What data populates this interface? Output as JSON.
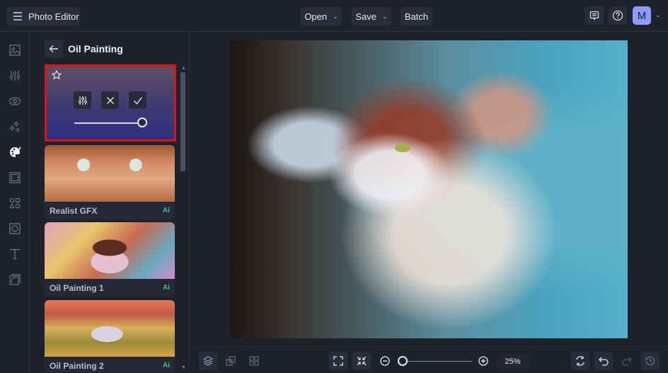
{
  "topbar": {
    "app_title": "Photo Editor",
    "open_label": "Open",
    "save_label": "Save",
    "batch_label": "Batch",
    "avatar_initial": "M",
    "chevron": "⌄"
  },
  "leftrail": {
    "items": [
      {
        "name": "image",
        "icon": "image-icon",
        "active": false
      },
      {
        "name": "adjust",
        "icon": "sliders-icon",
        "active": false
      },
      {
        "name": "touch-up",
        "icon": "eye-icon",
        "active": false
      },
      {
        "name": "effects",
        "icon": "sparkles-icon",
        "active": false
      },
      {
        "name": "artsy",
        "icon": "palette-icon",
        "active": true
      },
      {
        "name": "frames",
        "icon": "frame-icon",
        "active": false
      },
      {
        "name": "graphics",
        "icon": "shapes-icon",
        "active": false
      },
      {
        "name": "overlays",
        "icon": "overlay-icon",
        "active": false
      },
      {
        "name": "text",
        "icon": "text-icon",
        "active": false
      },
      {
        "name": "textures",
        "icon": "texture-icon",
        "active": false
      }
    ]
  },
  "panel": {
    "title": "Oil Painting",
    "selected_intensity": 1.0,
    "presets": [
      {
        "label": "Realist GFX",
        "badge": "Ai"
      },
      {
        "label": "Oil Painting 1",
        "badge": "Ai"
      },
      {
        "label": "Oil Painting 2",
        "badge": "Ai"
      }
    ]
  },
  "bottombar": {
    "zoom_value": "25%",
    "zoom_level": 0.25
  },
  "colors": {
    "accent": "#8b9bff",
    "selection_border": "#e01010",
    "ai_badge": "#3fbf8a",
    "background": "#1f222d"
  }
}
